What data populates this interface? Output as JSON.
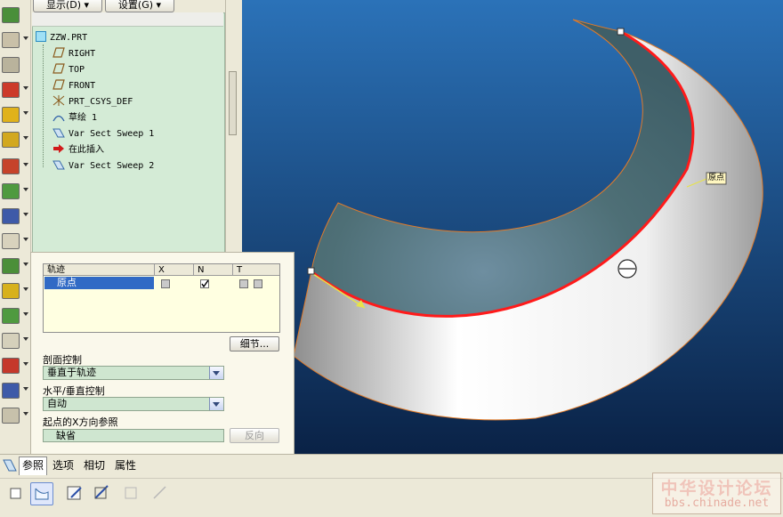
{
  "top_buttons": {
    "display": "显示(D)",
    "settings": "设置(G)"
  },
  "tree": {
    "items": [
      {
        "label": "ZZW.PRT",
        "icon": "part-icon"
      },
      {
        "label": "RIGHT",
        "icon": "datum-plane-icon"
      },
      {
        "label": "TOP",
        "icon": "datum-plane-icon"
      },
      {
        "label": "FRONT",
        "icon": "datum-plane-icon"
      },
      {
        "label": "PRT_CSYS_DEF",
        "icon": "csys-icon"
      },
      {
        "label": "草绘 1",
        "icon": "sketch-icon"
      },
      {
        "label": "Var Sect Sweep 1",
        "icon": "sweep-icon"
      },
      {
        "label": "在此插入",
        "icon": "insert-here-arrow-icon"
      },
      {
        "label": "Var Sect Sweep 2",
        "icon": "sweep-icon"
      }
    ]
  },
  "graphics": {
    "origin_tag": "原点",
    "colors": {
      "background_top": "#2a6fb5",
      "background_bottom": "#0a2448",
      "trajectory": "#ff1a1a",
      "surface_teal": "#4f7178"
    }
  },
  "trajectory_table": {
    "headers": {
      "name": "轨迹",
      "x": "X",
      "n": "N",
      "t": "T"
    },
    "rows": [
      {
        "name": "原点",
        "x_checked": false,
        "n_checked": true
      }
    ]
  },
  "details_button": "细节...",
  "section_control": {
    "label": "剖面控制",
    "value": "垂直于轨迹"
  },
  "hv_control": {
    "label": "水平/垂直控制",
    "value": "自动"
  },
  "x_ref": {
    "label": "起点的X方向参照",
    "value": "缺省",
    "flip_button": "反向"
  },
  "tabs": [
    "参照",
    "选项",
    "相切",
    "属性"
  ],
  "watermark": {
    "text": "中华设计论坛",
    "url": "bbs.chinade.net"
  }
}
